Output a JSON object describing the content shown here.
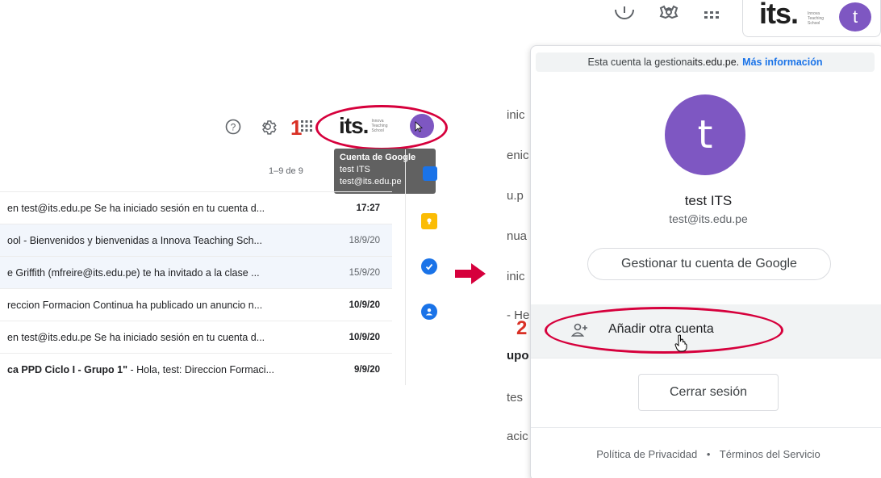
{
  "left": {
    "step_label": "1",
    "logo_text": "its.",
    "logo_sub": "Innova Teaching School",
    "tooltip": {
      "title": "Cuenta de Google",
      "name": "test ITS",
      "email": "test@its.edu.pe"
    },
    "pager": "1–9 de 9",
    "emails": [
      {
        "snippet": "en test@its.edu.pe Se ha iniciado sesión en tu cuenta d...",
        "date": "17:27",
        "unread": true
      },
      {
        "snippet": "ool - Bienvenidos y bienvenidas a Innova Teaching Sch...",
        "date": "18/9/20",
        "unread": false
      },
      {
        "snippet": "e Griffith (mfreire@its.edu.pe) te ha invitado a la clase ...",
        "date": "15/9/20",
        "unread": false
      },
      {
        "snippet": "reccion Formacion Continua ha publicado un anuncio n...",
        "date": "10/9/20",
        "unread": true
      },
      {
        "snippet": "en test@its.edu.pe Se ha iniciado sesión en tu cuenta d...",
        "date": "10/9/20",
        "unread": true
      },
      {
        "snippet_bold": "ca PPD Ciclo I - Grupo 1\"",
        "snippet": " - Hola, test: Direccion Formaci...",
        "date": "9/9/20",
        "unread": true
      }
    ]
  },
  "right": {
    "step_label": "2",
    "avatar_letter": "t",
    "bg_strip": [
      "inic",
      "enic",
      "u.p",
      "nua",
      "inic",
      "- He",
      "upo",
      "tes",
      "acic"
    ],
    "managed_text": "Esta cuenta la gestiona ",
    "managed_domain": "its.edu.pe.",
    "managed_link": "Más información",
    "user_name": "test ITS",
    "user_email": "test@its.edu.pe",
    "manage_button": "Gestionar tu cuenta de Google",
    "add_account": "Añadir otra cuenta",
    "sign_out": "Cerrar sesión",
    "footer_privacy": "Política de Privacidad",
    "footer_dot": "•",
    "footer_terms": "Términos del Servicio"
  },
  "colors": {
    "accent_red": "#d6003c",
    "avatar_purple": "#7e57c2",
    "link_blue": "#1a73e8"
  }
}
